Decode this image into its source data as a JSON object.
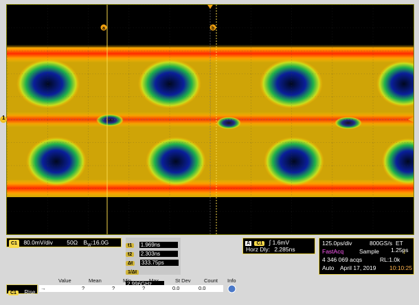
{
  "waveform": {
    "cursor_a_label": "a",
    "cursor_b_label": "b",
    "channel_marker": "1",
    "colors": {
      "hot": "#ff2a00",
      "warm": "#ffa200",
      "mid": "#dfe21a",
      "cool": "#2fd05a",
      "cold": "#1b3fd8",
      "cursor": "#f7d94a"
    }
  },
  "channel_panel": {
    "tag": "C1",
    "scale": "80.0mV/div",
    "impedance": "50Ω",
    "bandwidth_prefix": "B",
    "bandwidth_sub": "W",
    "bandwidth": ":16.0G"
  },
  "cursor_panel": {
    "rows": [
      {
        "tag": "t1",
        "value": "1.969ns"
      },
      {
        "tag": "t2",
        "value": "2.303ns"
      },
      {
        "tag": "Δt",
        "value": "333.75ps"
      },
      {
        "tag": "1/Δt",
        "value": "2.996GHz"
      }
    ]
  },
  "trigger_panel": {
    "mode_tag": "A",
    "channel_tag": "C1",
    "slope_icon": "rising-edge",
    "level": "1.6mV",
    "horz_dly_label": "Horz Dly:",
    "horz_dly": "2.285ns"
  },
  "acq_panel": {
    "timebase": "125.0ps/div",
    "sample_rate": "800GS/s",
    "et": "ET",
    "et_value": "1.25ps",
    "mode": "FastAcq",
    "sample": "Sample",
    "acqs": "4 346 069 acqs",
    "record_length": "RL:1.0k",
    "run_mode": "Auto",
    "date": "April 17, 2019",
    "time": "10:10:25"
  },
  "measurements": {
    "headers": [
      "Value",
      "Mean",
      "Min",
      "Max",
      "St Dev",
      "Count",
      "Info"
    ],
    "row": {
      "tag": "C1",
      "name": "Rise",
      "value": "→",
      "mean": "?",
      "min": "?",
      "max": "?",
      "stdev": "0.0",
      "count": "0.0"
    }
  }
}
